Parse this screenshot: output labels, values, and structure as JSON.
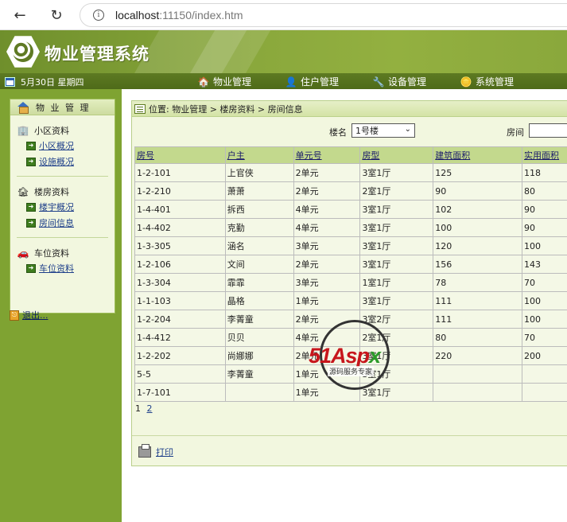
{
  "browser": {
    "url_host": "localhost",
    "url_rest": ":11150/index.htm"
  },
  "header": {
    "title": "物业管理系统"
  },
  "menubar": {
    "date": "5月30日 星期四",
    "items": [
      {
        "label": "物业管理",
        "icon": "house-icon"
      },
      {
        "label": "住户管理",
        "icon": "person-icon"
      },
      {
        "label": "设备管理",
        "icon": "tools-icon"
      },
      {
        "label": "系统管理",
        "icon": "coins-icon"
      }
    ]
  },
  "sidebar": {
    "title": "物 业 管 理",
    "groups": [
      {
        "title": "小区资料",
        "links": [
          "小区概况",
          "设施概况"
        ]
      },
      {
        "title": "楼房资料",
        "links": [
          "楼宇概况",
          "房间信息"
        ]
      },
      {
        "title": "车位资料",
        "links": [
          "车位资料"
        ]
      }
    ],
    "logout": "退出..."
  },
  "main": {
    "breadcrumb": "位置: 物业管理 > 楼房资料 > 房间信息",
    "filter": {
      "building_label": "楼名",
      "building_value": "1号楼",
      "room_label": "房间"
    },
    "table": {
      "headers": [
        "房号",
        "户主",
        "单元号",
        "房型",
        "建筑面积",
        "实用面积"
      ],
      "rows": [
        [
          "1-2-101",
          "上官侠",
          "2单元",
          "3室1厅",
          "125",
          "118"
        ],
        [
          "1-2-210",
          "萧萧",
          "2单元",
          "2室1厅",
          "90",
          "80"
        ],
        [
          "1-4-401",
          "拆西",
          "4单元",
          "3室1厅",
          "102",
          "90"
        ],
        [
          "1-4-402",
          "克勤",
          "4单元",
          "3室1厅",
          "100",
          "90"
        ],
        [
          "1-3-305",
          "涵名",
          "3单元",
          "3室1厅",
          "120",
          "100"
        ],
        [
          "1-2-106",
          "文间",
          "2单元",
          "3室1厅",
          "156",
          "143"
        ],
        [
          "1-3-304",
          "霏霏",
          "3单元",
          "1室1厅",
          "78",
          "70"
        ],
        [
          "1-1-103",
          "晶格",
          "1单元",
          "3室1厅",
          "111",
          "100"
        ],
        [
          "1-2-204",
          "李菁童",
          "2单元",
          "3室2厅",
          "111",
          "100"
        ],
        [
          "1-4-412",
          "贝贝",
          "4单元",
          "2室1厅",
          "80",
          "70"
        ],
        [
          "1-2-202",
          "尚娜娜",
          "2单元",
          "3室1厅",
          "220",
          "200"
        ],
        [
          "5-5",
          "李菁童",
          "1单元",
          "3室1厅",
          "",
          ""
        ],
        [
          "1-7-101",
          "",
          "1单元",
          "3室1厅",
          "",
          ""
        ]
      ]
    },
    "pager": {
      "current": "1",
      "next": "2"
    },
    "print_label": "打印"
  },
  "watermark": {
    "brand_red": "51Aspx",
    "subtitle": "源码服务专家"
  },
  "colors": {
    "header_green": "#8aa83c",
    "menubar_green": "#4e6a19",
    "sidebar_green": "#7fa332",
    "table_header": "#c3d98d",
    "panel_bg": "#f2f7df"
  }
}
